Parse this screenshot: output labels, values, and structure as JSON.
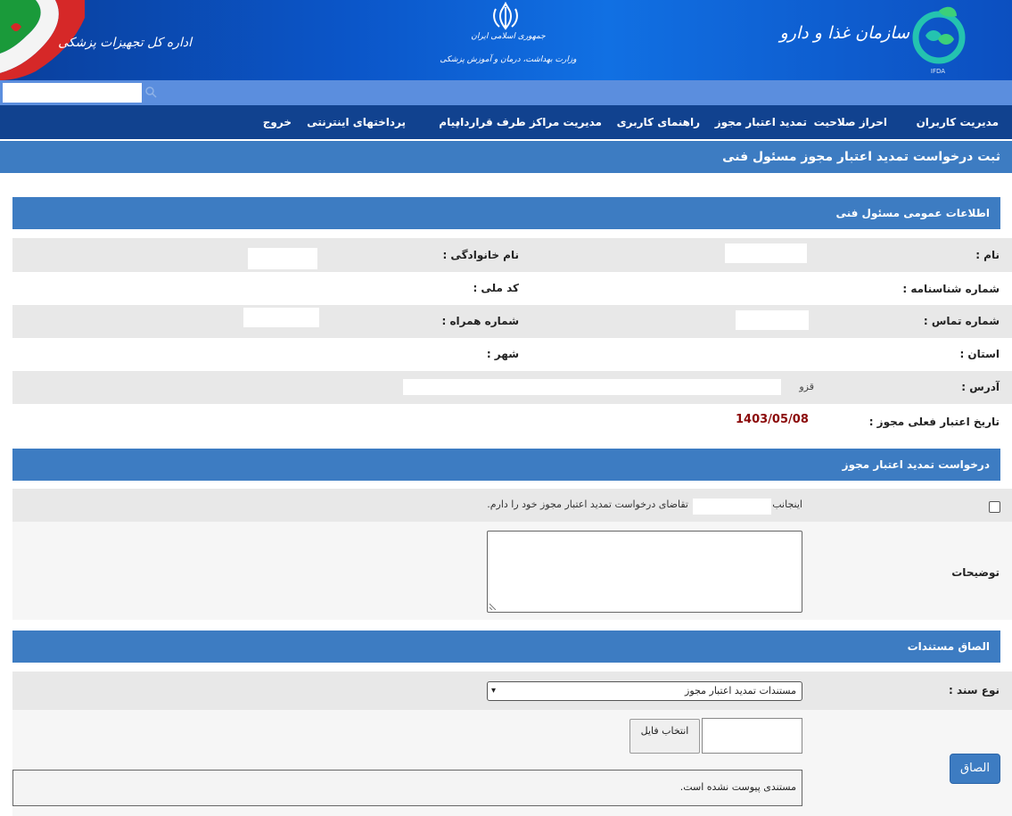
{
  "header": {
    "left_title": "اداره کل تجهیزات پزشکی",
    "center_line1": "جمهوری اسلامی ایران",
    "center_line2": "وزارت بهداشت، درمان و آموزش پزشکی",
    "right_title": "سازمان غذا و دارو",
    "logo_text": "IFDA"
  },
  "nav": {
    "items": [
      "مدیریت کاربران",
      "احراز صلاحیت",
      "تمدید اعتبار مجوز",
      "راهنمای کاربری",
      "مدیریت مراکز طرف قرارداد",
      "پیام",
      "پرداختهای اینترنتی",
      "خروج"
    ]
  },
  "page_title": "ثبت درخواست تمدید اعتبار مجوز مسئول فنی",
  "general_info": {
    "header": "اطلاعات عمومی مسئول فنی",
    "first_name_label": "نام :",
    "last_name_label": "نام خانوادگی :",
    "id_number_label": "شماره شناسنامه :",
    "national_code_label": "کد ملی :",
    "phone_label": "شماره تماس :",
    "mobile_label": "شماره همراه :",
    "province_label": "استان :",
    "city_label": "شهر :",
    "address_label": "آدرس :",
    "address_value": "قزو",
    "current_validity_label": "تاریخ اعتبار فعلی مجوز :",
    "current_validity_value": "1403/05/08"
  },
  "request": {
    "header": "درخواست تمدید اعتبار مجوز",
    "consent_prefix": "اینجانب",
    "consent_suffix": "تقاضای درخواست تمدید اعتبار مجوز خود را دارم.",
    "consent_checked": false,
    "description_label": "توضیحات"
  },
  "documents": {
    "header": "الصاق مستندات",
    "doc_type_label": "نوع سند :",
    "doc_type_selected": "مستندات تمدید اعتبار مجوز",
    "choose_file_label": "انتخاب فایل",
    "attach_button": "الصاق",
    "empty_message": "مستندی پیوست نشده است."
  },
  "colors": {
    "nav_bg": "#11428f",
    "section_bg": "#3d7cc2",
    "date_color": "#8b0a0a"
  }
}
